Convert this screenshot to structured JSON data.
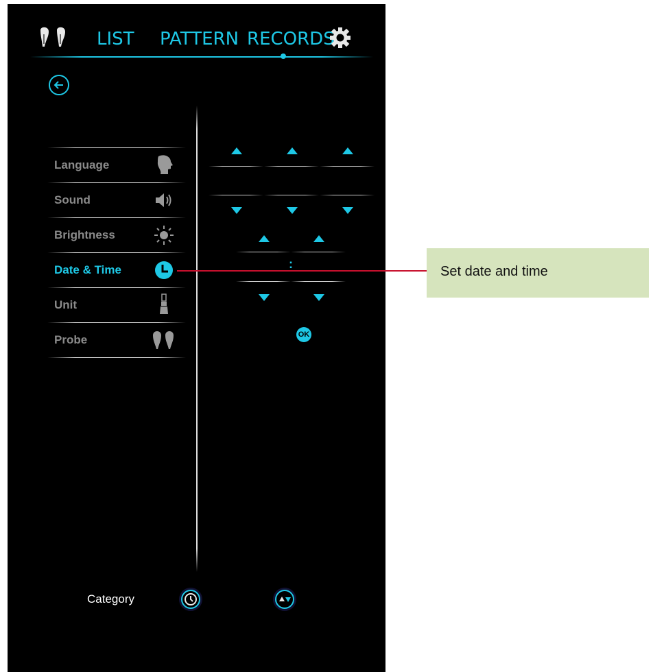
{
  "header": {
    "tabs": [
      {
        "label": "LIST"
      },
      {
        "label": "PATTERN"
      },
      {
        "label": "RECORDS"
      }
    ],
    "active_tab_index": 2,
    "icons": [
      "earbuds-icon",
      "gear-icon"
    ]
  },
  "settings_menu": {
    "items": [
      {
        "label": "Language",
        "icon": "head-profile-icon",
        "active": false
      },
      {
        "label": "Sound",
        "icon": "speaker-icon",
        "active": false
      },
      {
        "label": "Brightness",
        "icon": "sun-icon",
        "active": false
      },
      {
        "label": "Date & Time",
        "icon": "clock-icon",
        "active": true
      },
      {
        "label": "Unit",
        "icon": "unit-device-icon",
        "active": false
      },
      {
        "label": "Probe",
        "icon": "probe-icon",
        "active": false
      }
    ]
  },
  "date_time_panel": {
    "time_separator": ":",
    "ok_label": "OK"
  },
  "footer": {
    "category_label": "Category",
    "icons": [
      "clock-icon",
      "up-down-icon"
    ]
  },
  "annotation": {
    "text": "Set date and time"
  },
  "colors": {
    "accent": "#1ec8e6",
    "background": "#000000",
    "callout_bg": "#d6e4bd",
    "leader_line": "#c8102e"
  }
}
